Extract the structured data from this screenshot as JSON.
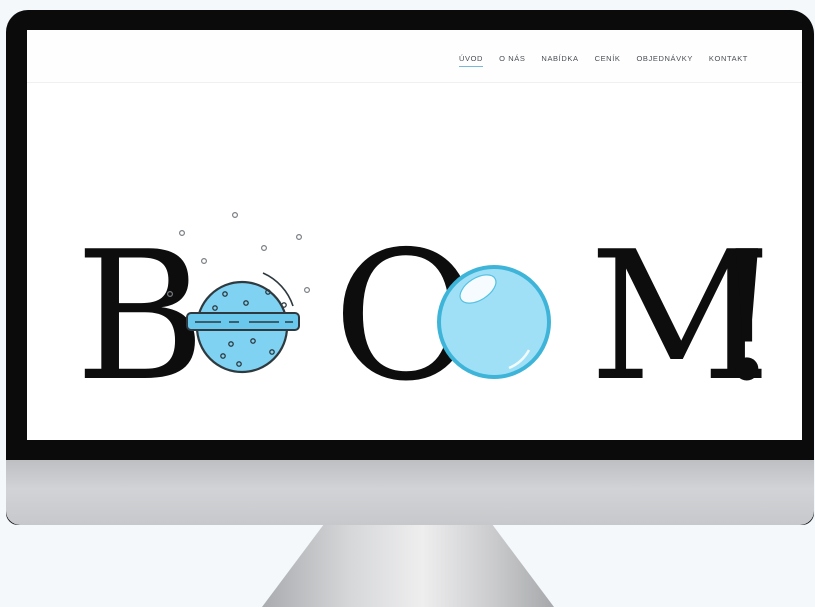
{
  "nav": {
    "items": [
      {
        "label": "ÚVOD",
        "active": true
      },
      {
        "label": "O NÁS"
      },
      {
        "label": "NABÍDKA"
      },
      {
        "label": "CENÍK"
      },
      {
        "label": "OBJEDNÁVKY"
      },
      {
        "label": "KONTAKT"
      }
    ],
    "accent_color": "#7ab8d8"
  },
  "hero": {
    "letters": {
      "b": "B",
      "o": "O",
      "m": "M",
      "excl": "!"
    },
    "icons": [
      "bath-bomb-icon",
      "bubble-icon"
    ],
    "bubble_color": "#9fe0f7",
    "bath_bomb_color": "#7fd2f1"
  }
}
